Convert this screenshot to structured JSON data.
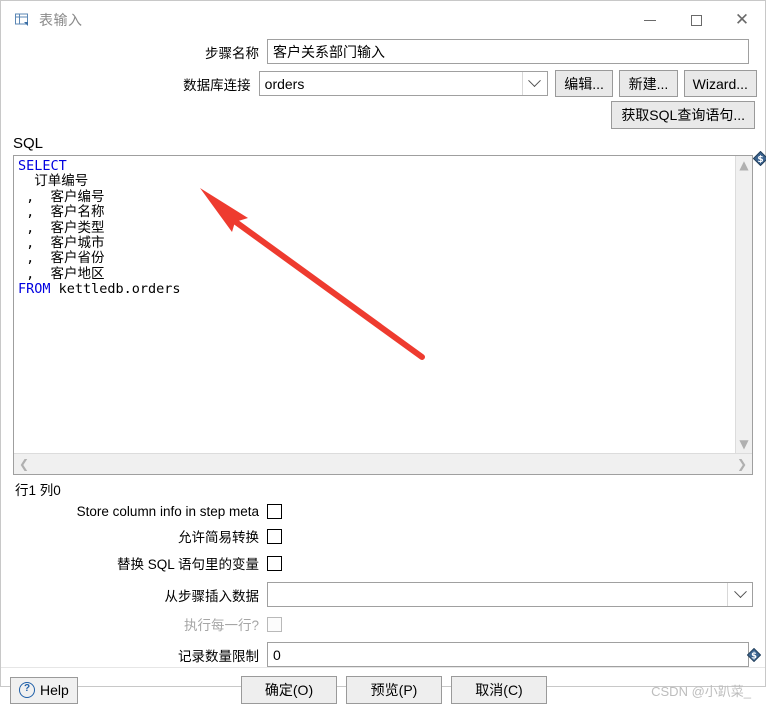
{
  "window": {
    "title": "表输入",
    "icon": "table-input-icon",
    "controls": {
      "minimize": "minimize-icon",
      "maximize": "maximize-icon",
      "close": "close-icon"
    }
  },
  "form": {
    "step_name": {
      "label": "步骤名称",
      "value": "客户关系部门输入",
      "placeholder": ""
    },
    "connection": {
      "label": "数据库连接",
      "value": "orders",
      "options": [
        "orders"
      ],
      "buttons": {
        "edit": "编辑...",
        "new": "新建...",
        "wizard": "Wizard..."
      }
    },
    "get_sql_button": "获取SQL查询语句..."
  },
  "sql": {
    "label": "SQL",
    "lines": [
      {
        "keyword": "SELECT",
        "rest": ""
      },
      {
        "keyword": "",
        "rest": "  订单编号"
      },
      {
        "keyword": "",
        "rest": " ,  客户编号"
      },
      {
        "keyword": "",
        "rest": " ,  客户名称"
      },
      {
        "keyword": "",
        "rest": " ,  客户类型"
      },
      {
        "keyword": "",
        "rest": " ,  客户城市"
      },
      {
        "keyword": "",
        "rest": " ,  客户省份"
      },
      {
        "keyword": "",
        "rest": " ,  客户地区"
      },
      {
        "keyword": "FROM",
        "rest": " kettledb.orders"
      }
    ],
    "status": "行1 列0",
    "variable_icon": "dollar-diamond-icon",
    "scroll_up": "▲",
    "scroll_down": "▼",
    "scroll_left": "❮",
    "scroll_right": "❯"
  },
  "options": {
    "store_column_info": {
      "label": "Store column info in step meta",
      "checked": false,
      "enabled": true
    },
    "lazy_conversion": {
      "label": "允许简易转换",
      "checked": false,
      "enabled": true
    },
    "replace_variables": {
      "label": "替换 SQL 语句里的变量",
      "checked": false,
      "enabled": true
    },
    "insert_data_from_step": {
      "label": "从步骤插入数据",
      "value": "",
      "options": []
    },
    "execute_each_row": {
      "label": "执行每一行?",
      "checked": false,
      "enabled": false
    },
    "row_limit": {
      "label": "记录数量限制",
      "value": "0",
      "variable_icon": "dollar-diamond-icon"
    }
  },
  "footer": {
    "help": "Help",
    "help_icon": "question-circle-icon",
    "ok": "确定(O)",
    "preview": "预览(P)",
    "cancel": "取消(C)",
    "watermark": "CSDN @小趴菜_"
  },
  "annotation": {
    "arrow_color": "#ee3b2f"
  }
}
